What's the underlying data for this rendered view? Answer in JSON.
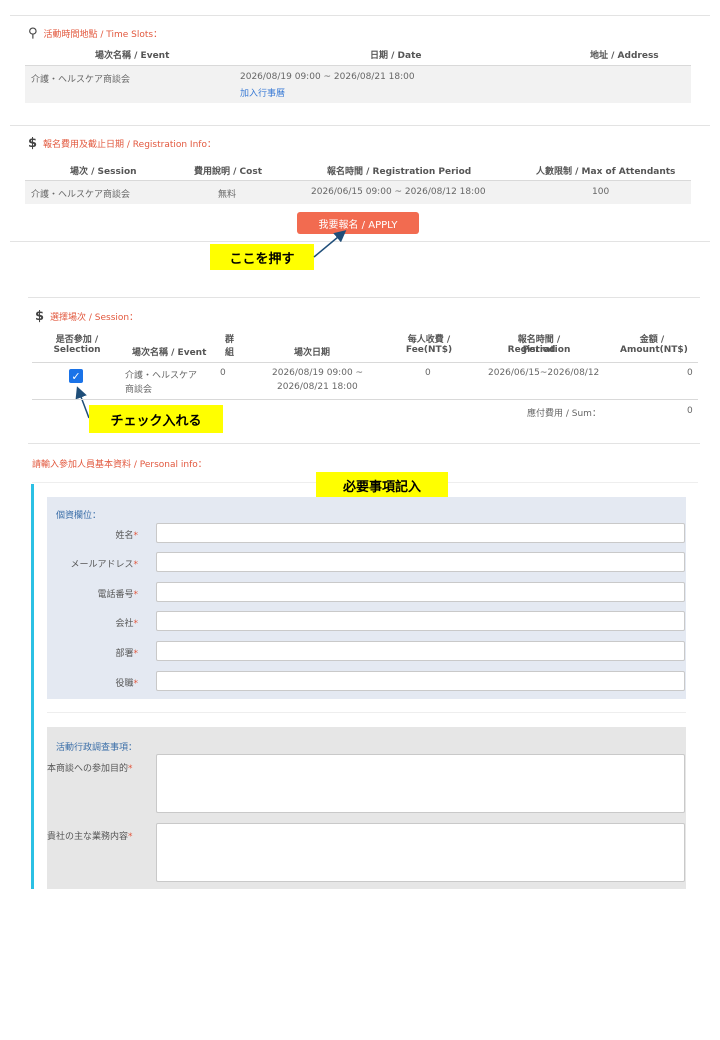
{
  "time_slots": {
    "title": "活動時間地點 / Time Slots：",
    "icon": "map-pin-icon",
    "headers": {
      "event": "場次名稱 / Event",
      "date": "日期 / Date",
      "address": "地址 / Address"
    },
    "row": {
      "event": "介護・ヘルスケア商談会",
      "date": "2026/08/19 09:00 ~ 2026/08/21 18:00",
      "calendar_link": "加入行事曆",
      "address": ""
    }
  },
  "registration_info": {
    "title": "報名費用及截止日期 / Registration Info：",
    "icon": "dollar-icon",
    "headers": {
      "session": "場次 / Session",
      "cost": "費用說明 / Cost",
      "period": "報名時間 / Registration Period",
      "max": "人數限制 / Max of Attendants"
    },
    "row": {
      "session": "介護・ヘルスケア商談会",
      "cost": "無料",
      "period": "2026/06/15 09:00 ~ 2026/08/12 18:00",
      "max": "100"
    },
    "apply_label": "我要報名 / APPLY"
  },
  "annotations": {
    "press_here": "ここを押す",
    "check_it": "チェック入れる",
    "fill_required": "必要事項記入"
  },
  "session_select": {
    "title": "選擇場次 / Session：",
    "icon": "dollar-icon",
    "headers": {
      "selection_1": "是否參加 /",
      "selection_2": "Selection",
      "event": "場次名稱 / Event",
      "group_1": "群",
      "group_2": "組",
      "date": "場次日期",
      "fee_1": "每人收費 /",
      "fee_2": "Fee(NT$)",
      "period_1": "報名時間 / Registration",
      "period_2": "Period",
      "amount_1": "金額 /",
      "amount_2": "Amount(NT$)"
    },
    "row": {
      "checked": true,
      "event_1": "介護・ヘルスケア",
      "event_2": "商談会",
      "group": "0",
      "date_1": "2026/08/19 09:00 ~",
      "date_2": "2026/08/21 18:00",
      "fee": "0",
      "period": "2026/06/15~2026/08/12",
      "amount": "0"
    },
    "sum_label": "應付費用 / Sum：",
    "sum_value": "0"
  },
  "personal_info": {
    "title": "請輸入參加人員基本資料 / Personal info：",
    "personal_section_title": "個資欄位：",
    "fields": [
      {
        "label": "姓名",
        "value": ""
      },
      {
        "label": "メールアドレス",
        "value": ""
      },
      {
        "label": "電話番号",
        "value": ""
      },
      {
        "label": "会社",
        "value": ""
      },
      {
        "label": "部署",
        "value": ""
      },
      {
        "label": "役職",
        "value": ""
      }
    ],
    "survey_section_title": "活動行政調查事項：",
    "survey_fields": [
      {
        "label": "本商談への参加目的",
        "value": ""
      },
      {
        "label": "貴社の主な業務内容",
        "value": ""
      }
    ],
    "required_mark": "*"
  },
  "colors": {
    "accent": "#e2583e",
    "button": "#f26b50",
    "highlight": "#ffff00",
    "checkbox": "#1a73e8",
    "bar": "#2bc0e4"
  }
}
